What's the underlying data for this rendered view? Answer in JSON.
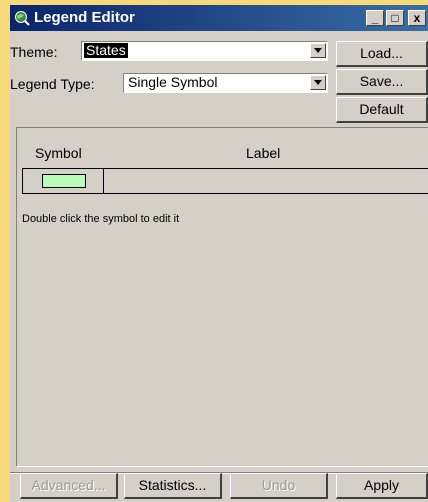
{
  "window": {
    "title": "Legend Editor",
    "minimize_glyph": "_",
    "maximize_glyph": "□",
    "close_glyph": "x"
  },
  "theme": {
    "label": "Theme:",
    "value": "States"
  },
  "legend_type": {
    "label": "Legend Type:",
    "value": "Single Symbol"
  },
  "buttons": {
    "load": "Load...",
    "save": "Save...",
    "default": "Default"
  },
  "table": {
    "headers": [
      "Symbol",
      "Label"
    ],
    "rows": [
      {
        "symbol_color": "#b8fcb8",
        "label": ""
      }
    ]
  },
  "hint": "Double click the symbol to edit it",
  "bottom_buttons": {
    "advanced": "Advanced...",
    "statistics": "Statistics...",
    "undo": "Undo",
    "apply": "Apply"
  },
  "colors": {
    "title_bar": "#0a246a",
    "face": "#d4d0c8",
    "symbol_fill": "#b8fcb8"
  }
}
